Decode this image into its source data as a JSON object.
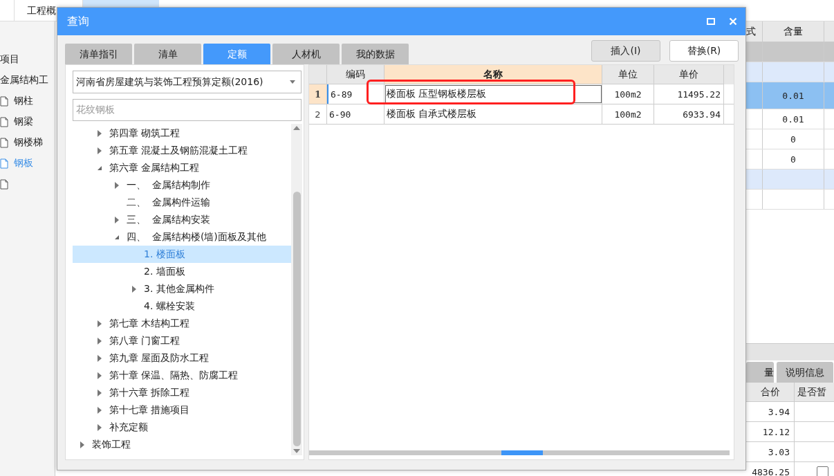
{
  "app_tabs": [
    {
      "label": "工程概",
      "selected": false
    }
  ],
  "project_tree": [
    {
      "kind": "heading",
      "label": "项目",
      "selected": false
    },
    {
      "kind": "heading",
      "label": "金属结构工",
      "selected": false
    },
    {
      "kind": "file",
      "label": "钢柱",
      "selected": false
    },
    {
      "kind": "file",
      "label": "钢梁",
      "selected": false
    },
    {
      "kind": "file",
      "label": "钢楼梯",
      "selected": false
    },
    {
      "kind": "file",
      "label": "钢板",
      "selected": true
    },
    {
      "kind": "file",
      "selected": false
    }
  ],
  "background_table": {
    "columns": [
      "式",
      "含量"
    ],
    "rows": [
      {
        "kind": "group",
        "selected": false
      },
      {
        "kind": "subgroup",
        "selected": false
      },
      {
        "kind": "item",
        "amount": "0.01",
        "selected": true
      },
      {
        "kind": "item",
        "amount": "0.01",
        "selected": false
      },
      {
        "kind": "item",
        "amount": "0",
        "selected": false
      },
      {
        "kind": "item",
        "amount": "0",
        "selected": false
      },
      {
        "kind": "subgroup",
        "selected": false
      },
      {
        "kind": "item",
        "selected": false
      }
    ]
  },
  "bottom_panel": {
    "tabs": [
      {
        "label": "量",
        "selected": false
      },
      {
        "label": "说明信息",
        "selected": false
      }
    ],
    "columns": [
      "合价",
      "是否暂"
    ],
    "rows": [
      {
        "total": "3.94"
      },
      {
        "total": "12.12"
      },
      {
        "total": "3.03"
      },
      {
        "total": "4836.25",
        "checked": false
      }
    ]
  },
  "dialog": {
    "title": "查询",
    "tabs": [
      {
        "label": "清单指引",
        "selected": false
      },
      {
        "label": "清单",
        "selected": false
      },
      {
        "label": "定额",
        "selected": true
      },
      {
        "label": "人材机",
        "selected": false
      },
      {
        "label": "我的数据",
        "selected": false
      }
    ],
    "buttons": [
      {
        "label": "插入(I)",
        "kind": "default"
      },
      {
        "label": "替换(R)",
        "kind": "primary"
      }
    ],
    "library": {
      "value": "河南省房屋建筑与装饰工程预算定额(2016)"
    },
    "search": {
      "value": "花纹钢板"
    },
    "tree": {
      "items": [
        {
          "children": [
            {
              "label": "第四章 砌筑工程",
              "expanded": false,
              "selected": false
            },
            {
              "label": "第五章 混凝土及钢筋混凝土工程",
              "expanded": false,
              "selected": false
            },
            {
              "label": "第六章 金属结构工程",
              "expanded": true,
              "selected": false,
              "children": [
                {
                  "label": "一、  金属结构制作",
                  "expanded": false,
                  "selected": false
                },
                {
                  "label": "二、  金属构件运输",
                  "selected": false
                },
                {
                  "label": "三、  金属结构安装",
                  "expanded": false,
                  "selected": false
                },
                {
                  "label": "四、  金属结构楼(墙)面板及其他",
                  "expanded": true,
                  "selected": false,
                  "children": [
                    {
                      "label": "1. 楼面板",
                      "selected": true
                    },
                    {
                      "label": "2. 墙面板",
                      "selected": false
                    },
                    {
                      "label": "3. 其他金属构件",
                      "expanded": false,
                      "selected": false
                    },
                    {
                      "label": "4. 螺栓安装",
                      "selected": false
                    }
                  ]
                }
              ]
            },
            {
              "label": "第七章 木结构工程",
              "expanded": false,
              "selected": false
            },
            {
              "label": "第八章 门窗工程",
              "expanded": false,
              "selected": false
            },
            {
              "label": "第九章 屋面及防水工程",
              "expanded": false,
              "selected": false
            },
            {
              "label": "第十章 保温、隔热、防腐工程",
              "expanded": false,
              "selected": false
            },
            {
              "label": "第十六章 拆除工程",
              "expanded": false,
              "selected": false
            },
            {
              "label": "第十七章 措施项目",
              "expanded": false,
              "selected": false
            },
            {
              "label": "补充定额",
              "expanded": false,
              "selected": false
            }
          ]
        },
        {
          "label": "装饰工程",
          "expanded": false,
          "selected": false
        }
      ]
    },
    "quota_table": {
      "columns": [
        {
          "label": "编码",
          "selected": false
        },
        {
          "label": "名称",
          "selected": true
        },
        {
          "label": "单位",
          "selected": false
        },
        {
          "label": "单价",
          "selected": false
        }
      ],
      "rows": [
        {
          "number": "1",
          "code": "6-89",
          "name": "楼面板 压型钢板楼层板",
          "unit": "100m2",
          "price": "11495.22",
          "selected": true
        },
        {
          "number": "2",
          "code": "6-90",
          "name": "楼面板 自承式楼层板",
          "unit": "100m2",
          "price": "6933.94",
          "selected": false
        }
      ]
    }
  }
}
